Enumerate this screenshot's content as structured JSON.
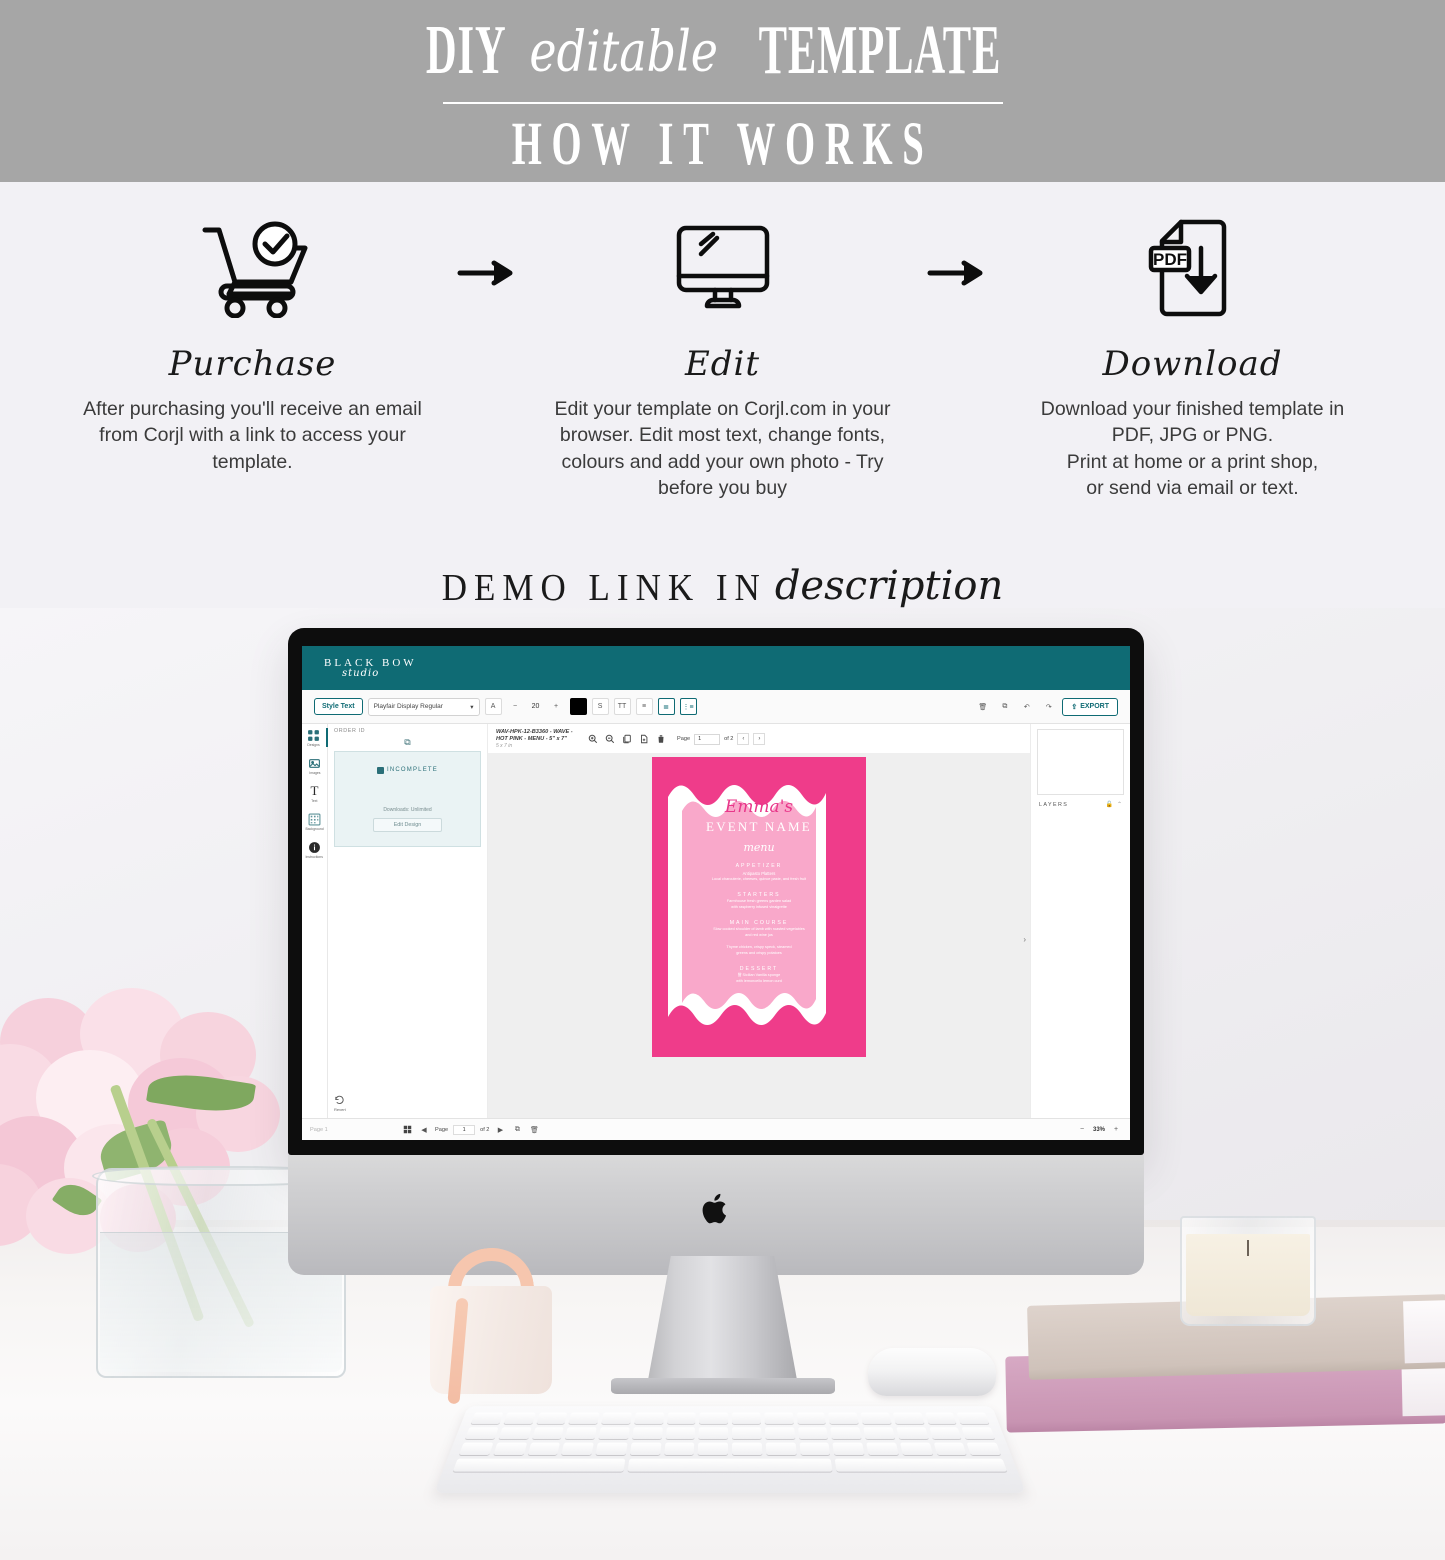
{
  "header": {
    "title_part1": "DIY",
    "title_script": "editable",
    "title_part2": "TEMPLATE",
    "subtitle": "HOW IT WORKS"
  },
  "steps": [
    {
      "icon": "shopping-cart-check-icon",
      "label": "Purchase",
      "description": "After purchasing you'll receive an email from Corjl with a link to access your template."
    },
    {
      "icon": "desktop-monitor-icon",
      "label": "Edit",
      "description": "Edit your template on Corjl.com in your browser. Edit most text, change fonts, colours and add your own photo - Try before you buy"
    },
    {
      "icon": "pdf-download-icon",
      "label": "Download",
      "description": "Download your finished template in PDF, JPG or PNG.\nPrint at home or a print shop,\nor send via email or text."
    }
  ],
  "arrow_icon": "arrow-right-icon",
  "demo": {
    "caps": "DEMO LINK IN",
    "script": "description"
  },
  "editor": {
    "brand": {
      "name": "BLACK BOW",
      "sub": "studio"
    },
    "toolbar": {
      "style_text": "Style Text",
      "font_family": "Playfair Display Regular",
      "font_size": "20",
      "minus": "−",
      "plus": "+",
      "color_swatch": "#000000",
      "letter_case_icon": "text-case-icon",
      "strike_icon": "strikethrough-icon",
      "caps_icon": "TT",
      "line_height_icon": "line-height-icon",
      "align_icon": "align-left-icon",
      "list_icon": "bullet-list-icon",
      "trash_icon": "trash-icon",
      "copy_icon": "copy-icon",
      "undo_icon": "undo-icon",
      "redo_icon": "redo-icon",
      "export_icon": "export-icon",
      "export_label": "EXPORT"
    },
    "rail": [
      {
        "icon": "designs-icon",
        "label": "Designs"
      },
      {
        "icon": "images-icon",
        "label": "Images"
      },
      {
        "icon": "text-icon",
        "label": "Text"
      },
      {
        "icon": "background-icon",
        "label": "Background"
      },
      {
        "icon": "instructions-info-icon",
        "label": "Instructions"
      }
    ],
    "panel": {
      "order_id_label": "ORDER ID",
      "duplicate_icon": "duplicate-icon",
      "status_badge": "INCOMPLETE",
      "downloads": "Downloads: Unlimited",
      "edit_design_button": "Edit Design",
      "revert_label": "Revert",
      "revert_icon": "revert-icon"
    },
    "canvas_bar": {
      "doc_name": "WAV-HPK-12-B3360 - WAVE - HOT PINK - MENU - 5\" x 7\"",
      "doc_size": "5 x 7 in",
      "zoom_in_icon": "zoom-in-icon",
      "zoom_out_icon": "zoom-out-icon",
      "copy_page_icon": "copy-page-icon",
      "add_page_icon": "add-page-icon",
      "delete_page_icon": "delete-page-icon",
      "page_label": "Page",
      "page_value": "1",
      "page_of": "of 2",
      "prev_icon": "chevron-left-icon",
      "next_icon": "chevron-right-icon"
    },
    "layers": {
      "title": "LAYERS",
      "lock_icon": "lock-icon",
      "collapse_icon": "chevron-up-icon"
    },
    "status_bar": {
      "page_name": "Page 1",
      "grid_icon": "grid-view-icon",
      "prev_icon": "play-left-icon",
      "page_label": "Page",
      "page_value": "1",
      "page_of": "of 2",
      "next_icon": "play-right-icon",
      "duplicate_icon": "duplicate-page-icon",
      "delete_icon": "trash-page-icon",
      "zoom_out": "−",
      "zoom_level": "33%",
      "zoom_in": "+"
    },
    "card": {
      "name": "Emma's",
      "event": "EVENT NAME",
      "menu_word": "menu",
      "sections": [
        {
          "heading": "APPETIZER",
          "line1": "Antipasto Platters",
          "line2": "Local charcuterie, cheeses, quince paste, and fresh fruit"
        },
        {
          "heading": "STARTERS",
          "line1": "Farmhouse fresh greens garden salad",
          "line2": "with raspberry infused vinaigrette"
        },
        {
          "heading": "MAIN COURSE",
          "line1": "Slow cooked shoulder of lamb with roasted vegetables",
          "line2": "and red wine jus",
          "line3": "Thyme chicken, crispy speck, steamed",
          "line4": "greens and crispy potatoes"
        },
        {
          "heading": "DESSERT",
          "line1": "嘗 Sicilian Vanilla sponge",
          "line2": "with lemoncello lemon curd"
        }
      ]
    }
  },
  "colors": {
    "banner_gray": "#a6a6a6",
    "page_bg": "#f2f1f5",
    "teal": "#0f6b74",
    "hot_pink": "#ef3c8a",
    "soft_pink": "#f9a8ca"
  }
}
